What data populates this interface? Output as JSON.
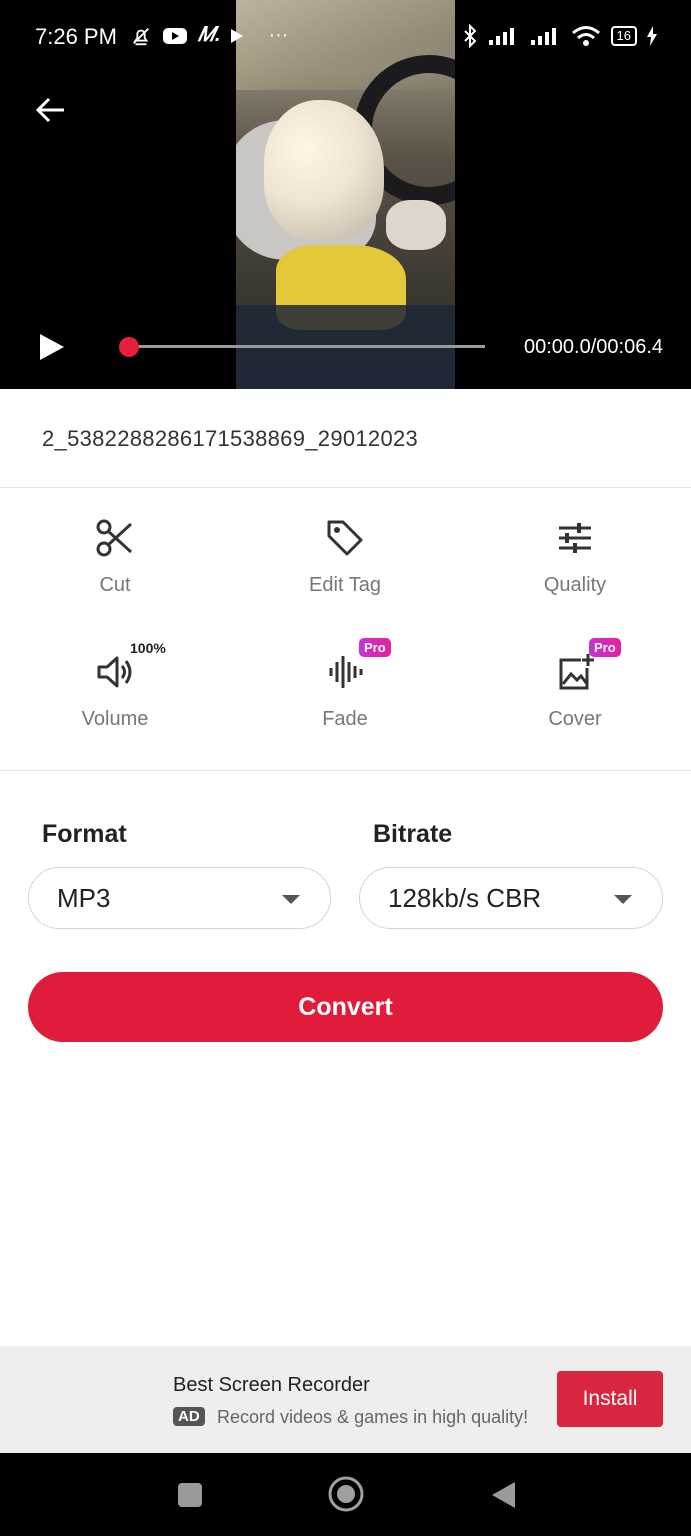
{
  "status_bar": {
    "time": "7:26 PM",
    "left_glyphs": "𝑀.",
    "more": "···",
    "battery": "16"
  },
  "player": {
    "time_readout": "00:00.0/00:06.4",
    "progress": 0.0
  },
  "file": {
    "name": "2_5382288286171538869_29012023"
  },
  "tools": [
    {
      "label": "Cut",
      "icon": "scissors-icon"
    },
    {
      "label": "Edit Tag",
      "icon": "tag-icon"
    },
    {
      "label": "Quality",
      "icon": "sliders-icon"
    },
    {
      "label": "Volume",
      "icon": "volume-icon",
      "badge": "100%"
    },
    {
      "label": "Fade",
      "icon": "waveform-icon",
      "badge": "Pro"
    },
    {
      "label": "Cover",
      "icon": "add-image-icon",
      "badge": "Pro"
    }
  ],
  "format": {
    "label": "Format",
    "value": "MP3"
  },
  "bitrate": {
    "label": "Bitrate",
    "value": "128kb/s CBR"
  },
  "convert": {
    "label": "Convert"
  },
  "ad": {
    "title": "Best Screen Recorder",
    "badge": "AD",
    "description": "Record videos & games in high quality!",
    "install_label": "Install"
  },
  "colors": {
    "accent": "#e01c3a",
    "pro_badge": "#d12cc0"
  }
}
